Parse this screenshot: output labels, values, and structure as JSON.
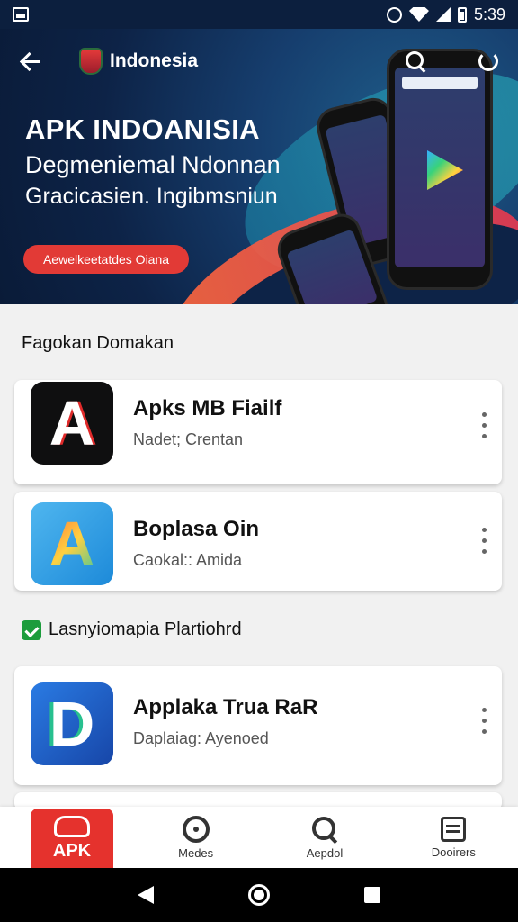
{
  "status_bar": {
    "time": "5:39"
  },
  "header": {
    "title": "Indonesia"
  },
  "hero": {
    "headline": "APK INDOANISIA",
    "line2": "Degmeniemal Ndonnan",
    "line3": "Gracicasien. Ingibmsniun",
    "cta_label": "Aewelkeetatdes Oiana"
  },
  "sections": {
    "featured_title": "Fagokan Domakan",
    "verified_title": "Lasnyiomapia Plartiohrd"
  },
  "apps": [
    {
      "name": "Apks MB Fiailf",
      "subtitle": "Nadet; Crentan",
      "icon_letter": "A"
    },
    {
      "name": "Boplasa Oin",
      "subtitle": "Caokal:: Amida",
      "icon_letter": "A"
    },
    {
      "name": "Applaka Trua RaR",
      "subtitle": "Daplaiag: Ayenoed",
      "icon_letter": "D"
    }
  ],
  "bottom_nav": [
    {
      "label": "APK",
      "icon": "apk-logo-icon"
    },
    {
      "label": "Medes",
      "icon": "target-icon"
    },
    {
      "label": "Aepdol",
      "icon": "search-icon"
    },
    {
      "label": "Dooirers",
      "icon": "list-icon"
    }
  ],
  "colors": {
    "accent": "#e5322d",
    "hero_dark": "#0d2347",
    "verified_green": "#1c9c3c"
  }
}
